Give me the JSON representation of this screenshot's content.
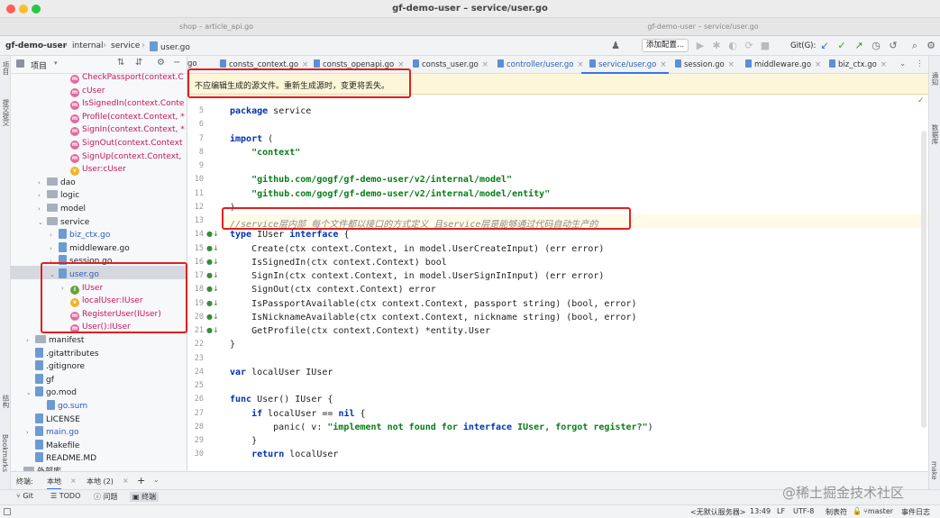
{
  "window": {
    "title": "gf-demo-user – service/user.go"
  },
  "window_tabs": [
    "shop – article_api.go",
    "gf-demo-user – service/user.go"
  ],
  "breadcrumb": [
    "gf-demo-user",
    "internal",
    "service",
    "user.go"
  ],
  "toolbar": {
    "add_config": "添加配置...",
    "git_label": "Git(G):"
  },
  "left_strip": {
    "project": "项目",
    "commit": "提交提交",
    "structure": "结构",
    "bookmarks": "Bookmarks"
  },
  "right_strip": {
    "notifications": "通知",
    "database": "数据库",
    "make": "make"
  },
  "project_panel": {
    "title": "项目",
    "rows": [
      {
        "label": "CheckPassport(context.C",
        "icon": "method",
        "indent": 4
      },
      {
        "label": "cUser",
        "icon": "method",
        "indent": 4
      },
      {
        "label": "IsSignedIn(context.Conte",
        "icon": "method",
        "indent": 4
      },
      {
        "label": "Profile(context.Context, *",
        "icon": "method",
        "indent": 4
      },
      {
        "label": "SignIn(context.Context, *",
        "icon": "method",
        "indent": 4
      },
      {
        "label": "SignOut(context.Context",
        "icon": "method",
        "indent": 4
      },
      {
        "label": "SignUp(context.Context,",
        "icon": "method",
        "indent": 4
      },
      {
        "label": "User:cUser",
        "icon": "var",
        "indent": 4
      },
      {
        "label": "dao",
        "icon": "folder",
        "indent": 2,
        "arrow": "›"
      },
      {
        "label": "logic",
        "icon": "folder",
        "indent": 2,
        "arrow": "›"
      },
      {
        "label": "model",
        "icon": "folder",
        "indent": 2,
        "arrow": "›"
      },
      {
        "label": "service",
        "icon": "folder",
        "indent": 2,
        "arrow": "⌄"
      },
      {
        "label": "biz_ctx.go",
        "icon": "file",
        "indent": 3,
        "arrow": "›"
      },
      {
        "label": "middleware.go",
        "icon": "file",
        "indent": 3,
        "arrow": "›"
      },
      {
        "label": "session.go",
        "icon": "file",
        "indent": 3,
        "arrow": "›"
      },
      {
        "label": "user.go",
        "icon": "file",
        "indent": 3,
        "arrow": "⌄"
      },
      {
        "label": "IUser",
        "icon": "interface",
        "indent": 4,
        "arrow": "›"
      },
      {
        "label": "localUser:IUser",
        "icon": "var",
        "indent": 4
      },
      {
        "label": "RegisterUser(IUser)",
        "icon": "method",
        "indent": 4
      },
      {
        "label": "User():IUser",
        "icon": "method",
        "indent": 4
      },
      {
        "label": "manifest",
        "icon": "folder",
        "indent": 1,
        "arrow": "›"
      },
      {
        "label": ".gitattributes",
        "icon": "file",
        "indent": 1
      },
      {
        "label": ".gitignore",
        "icon": "file",
        "indent": 1
      },
      {
        "label": "gf",
        "icon": "file",
        "indent": 1
      },
      {
        "label": "go.mod",
        "icon": "file",
        "indent": 1,
        "arrow": "⌄"
      },
      {
        "label": "go.sum",
        "icon": "file",
        "indent": 2
      },
      {
        "label": "LICENSE",
        "icon": "file",
        "indent": 1
      },
      {
        "label": "main.go",
        "icon": "file",
        "indent": 1,
        "arrow": "›"
      },
      {
        "label": "Makefile",
        "icon": "file",
        "indent": 1
      },
      {
        "label": "README.MD",
        "icon": "file",
        "indent": 1
      },
      {
        "label": "外部库",
        "icon": "folder",
        "indent": 0,
        "arrow": "›"
      }
    ]
  },
  "editor_tabs": [
    "go",
    "consts_context.go",
    "consts_openapi.go",
    "consts_user.go",
    "controller/user.go",
    "service/user.go",
    "session.go",
    "middleware.go",
    "biz_ctx.go"
  ],
  "banner": {
    "text": "不应编辑生成的源文件。重新生成源时，变更将丢失。"
  },
  "code_lines": [
    {
      "n": "5",
      "t": "package service"
    },
    {
      "n": "6",
      "t": ""
    },
    {
      "n": "7",
      "t": "import ("
    },
    {
      "n": "8",
      "t": "    \"context\""
    },
    {
      "n": "9",
      "t": ""
    },
    {
      "n": "10",
      "t": "    \"github.com/gogf/gf-demo-user/v2/internal/model\""
    },
    {
      "n": "11",
      "t": "    \"github.com/gogf/gf-demo-user/v2/internal/model/entity\""
    },
    {
      "n": "12",
      "t": ")"
    },
    {
      "n": "13",
      "t": "//service层内部 每个文件都以接口的方式定义 且service层是能够通过代码自动生产的"
    },
    {
      "n": "14",
      "t": "type IUser interface {"
    },
    {
      "n": "15",
      "t": "    Create(ctx context.Context, in model.UserCreateInput) (err error)"
    },
    {
      "n": "16",
      "t": "    IsSignedIn(ctx context.Context) bool"
    },
    {
      "n": "17",
      "t": "    SignIn(ctx context.Context, in model.UserSignInInput) (err error)"
    },
    {
      "n": "18",
      "t": "    SignOut(ctx context.Context) error"
    },
    {
      "n": "19",
      "t": "    IsPassportAvailable(ctx context.Context, passport string) (bool, error)"
    },
    {
      "n": "20",
      "t": "    IsNicknameAvailable(ctx context.Context, nickname string) (bool, error)"
    },
    {
      "n": "21",
      "t": "    GetProfile(ctx context.Context) *entity.User"
    },
    {
      "n": "22",
      "t": "}"
    },
    {
      "n": "23",
      "t": ""
    },
    {
      "n": "24",
      "t": "var localUser IUser"
    },
    {
      "n": "25",
      "t": ""
    },
    {
      "n": "26",
      "t": "func User() IUser {"
    },
    {
      "n": "27",
      "t": "    if localUser == nil {"
    },
    {
      "n": "28",
      "t": "        panic( v: \"implement not found for interface IUser, forgot register?\")"
    },
    {
      "n": "29",
      "t": "    }"
    },
    {
      "n": "30",
      "t": "    return localUser"
    }
  ],
  "bottom_tabs": {
    "terminal_label": "终端:",
    "tab1": "本地",
    "tab2": "本地 (2)",
    "add": "+"
  },
  "tool_windows": [
    "Git",
    "TODO",
    "问题",
    "终端"
  ],
  "status": {
    "service": "<无默认服务器>",
    "position": "13:49",
    "line_ending": "LF",
    "encoding": "UTF-8",
    "indent": "制表符",
    "branch": "master",
    "event_log": "事件日志"
  },
  "watermark": "@稀土掘金技术社区",
  "colors": {
    "accent": "#3574f0",
    "annotation_box": "#e02020",
    "banner_bg": "#fdf6d8"
  }
}
